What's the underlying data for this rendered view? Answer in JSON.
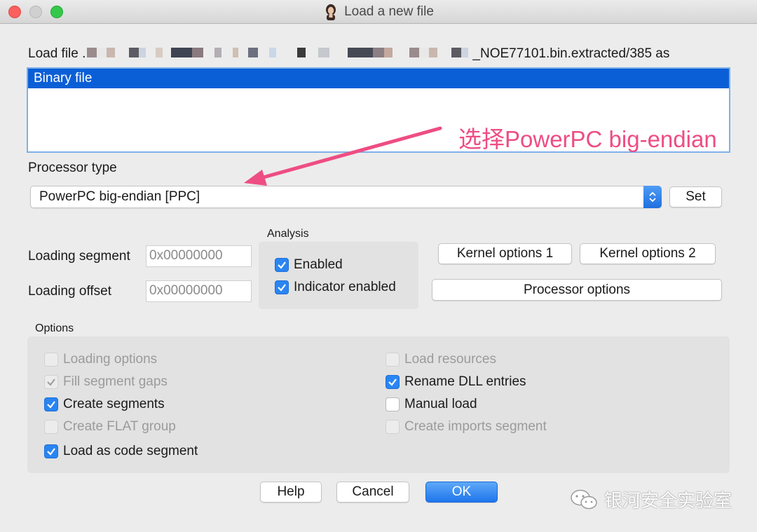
{
  "window": {
    "title": "Load a new file"
  },
  "load_file": {
    "prefix": "Load file .",
    "suffix": "_NOE77101.bin.extracted/385 as"
  },
  "file_types": [
    {
      "label": "Binary file",
      "selected": true
    }
  ],
  "annotation": {
    "text": "选择PowerPC big-endian",
    "color": "#ee4d84"
  },
  "processor": {
    "label": "Processor type",
    "value": "PowerPC big-endian [PPC]",
    "set_label": "Set"
  },
  "loading": {
    "segment_label": "Loading segment",
    "segment_value": "0x00000000",
    "offset_label": "Loading offset",
    "offset_value": "0x00000000"
  },
  "analysis": {
    "title": "Analysis",
    "enabled_label": "Enabled",
    "enabled": true,
    "indicator_label": "Indicator enabled",
    "indicator": true
  },
  "buttons": {
    "kernel1": "Kernel options 1",
    "kernel2": "Kernel options 2",
    "processor_options": "Processor options",
    "help": "Help",
    "cancel": "Cancel",
    "ok": "OK"
  },
  "options": {
    "title": "Options",
    "left": [
      {
        "label": "Loading options",
        "checked": false,
        "enabled": false
      },
      {
        "label": "Fill segment gaps",
        "checked": true,
        "enabled": false
      },
      {
        "label": "Create segments",
        "checked": true,
        "enabled": true
      },
      {
        "label": "Create FLAT group",
        "checked": false,
        "enabled": false
      },
      {
        "label": "Load as code segment",
        "checked": true,
        "enabled": true
      }
    ],
    "right": [
      {
        "label": "Load resources",
        "checked": false,
        "enabled": false
      },
      {
        "label": "Rename DLL entries",
        "checked": true,
        "enabled": true
      },
      {
        "label": "Manual load",
        "checked": false,
        "enabled": true
      },
      {
        "label": "Create imports segment",
        "checked": false,
        "enabled": false
      }
    ]
  },
  "watermark": {
    "text": "银河安全实验室"
  },
  "colors": {
    "accent": "#2a85f2",
    "selection": "#0b5fd6"
  }
}
